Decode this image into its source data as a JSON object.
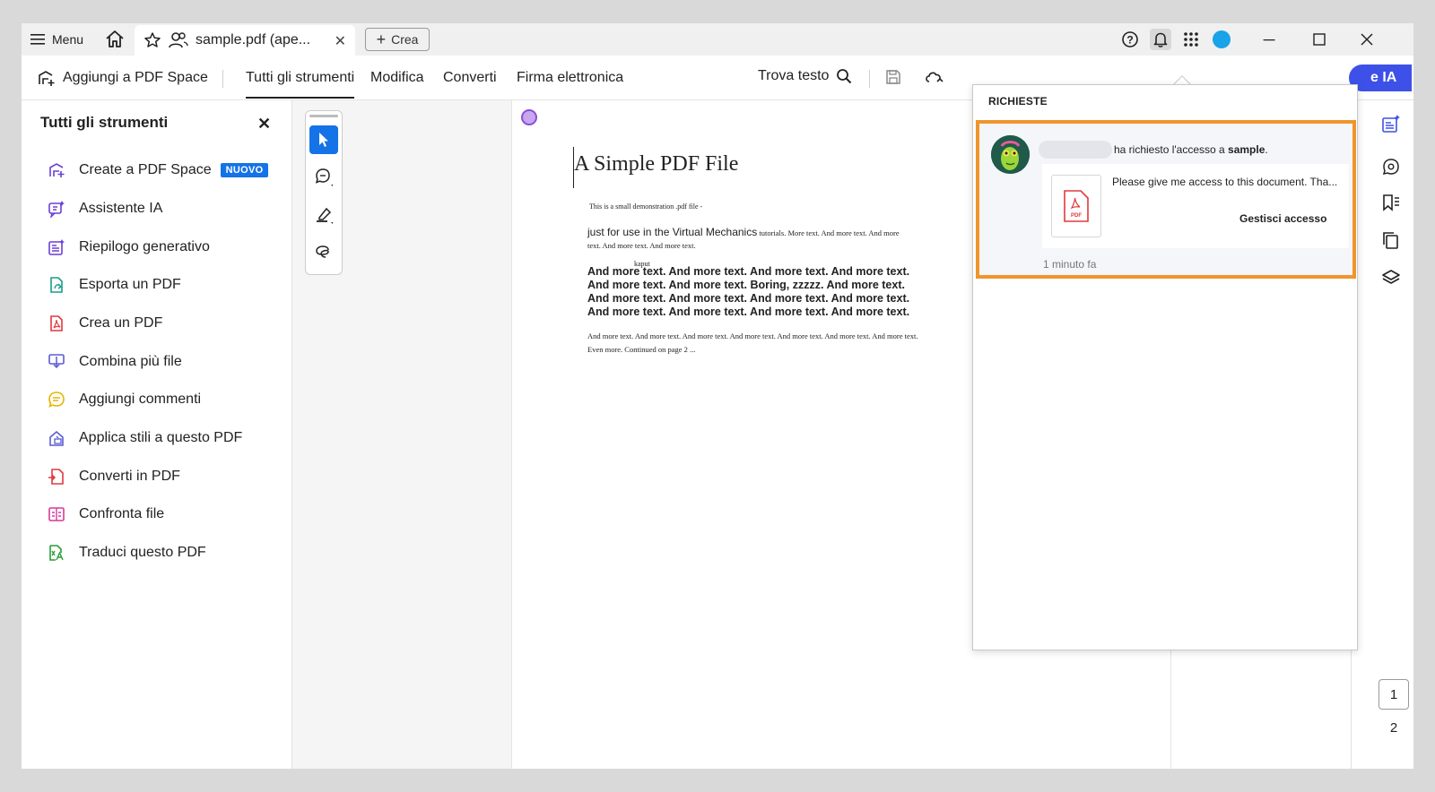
{
  "titlebar": {
    "menu_label": "Menu",
    "tab_title": "sample.pdf (ape...",
    "crea_label": "Crea"
  },
  "toolbar": {
    "add_space": "Aggiungi a PDF Space",
    "tabs": [
      "Tutti gli strumenti",
      "Modifica",
      "Converti",
      "Firma elettronica"
    ],
    "find_text": "Trova testo",
    "ia_label": "e IA"
  },
  "left_panel": {
    "title": "Tutti gli strumenti",
    "badge_new": "NUOVO",
    "tools": [
      {
        "label": "Create a PDF Space",
        "icon": "pdf-space-icon",
        "color": "#6b3fd6"
      },
      {
        "label": "Assistente IA",
        "icon": "ai-assistant-icon",
        "color": "#6b3fd6"
      },
      {
        "label": "Riepilogo generativo",
        "icon": "summary-icon",
        "color": "#6b3fd6"
      },
      {
        "label": "Esporta un PDF",
        "icon": "export-pdf-icon",
        "color": "#1a9c8a"
      },
      {
        "label": "Crea un PDF",
        "icon": "create-pdf-icon",
        "color": "#e0393e"
      },
      {
        "label": "Combina più file",
        "icon": "combine-files-icon",
        "color": "#5b5bd6"
      },
      {
        "label": "Aggiungi commenti",
        "icon": "comment-icon",
        "color": "#e8b400"
      },
      {
        "label": "Applica stili a questo PDF",
        "icon": "styles-icon",
        "color": "#5b5bd6"
      },
      {
        "label": "Converti in PDF",
        "icon": "convert-pdf-icon",
        "color": "#e0393e"
      },
      {
        "label": "Confronta file",
        "icon": "compare-files-icon",
        "color": "#d6399a"
      },
      {
        "label": "Traduci questo PDF",
        "icon": "translate-icon",
        "color": "#2a9c3a"
      }
    ]
  },
  "document": {
    "title": "A Simple PDF File",
    "p1": "This is a small demonstration .pdf file -",
    "p2_big": "just for use in the Virtual Mechanics",
    "p2_rest": " tutorials. More text. And more  text. And more text. And more text. And more text.",
    "kaput": "kaput",
    "p3": "And more text. And more text. And more text. And more text. And more  text. And more text. Boring, zzzzz. And more text. And more text. And  more text. And more text. And more text. And more text. And more text.  And more text. And more text.",
    "p4": "And more text. And more text. And more text. And more text. And more  text. And more text. And more text. Even more. Continued on page 2 ..."
  },
  "pages": {
    "current": "1",
    "next": "2"
  },
  "notifications": {
    "header": "RICHIESTE",
    "request_text": "ha richiesto l'accesso a ",
    "file_name": "sample",
    "request_suffix": ".",
    "message": "Please give me access to this document. Tha...",
    "file_label": "PDF",
    "manage_label": "Gestisci accesso",
    "time": "1 minuto fa",
    "highlight_color": "#f0952c"
  },
  "colors": {
    "accent": "#1473e6",
    "ai_button": "#3d51e8"
  }
}
